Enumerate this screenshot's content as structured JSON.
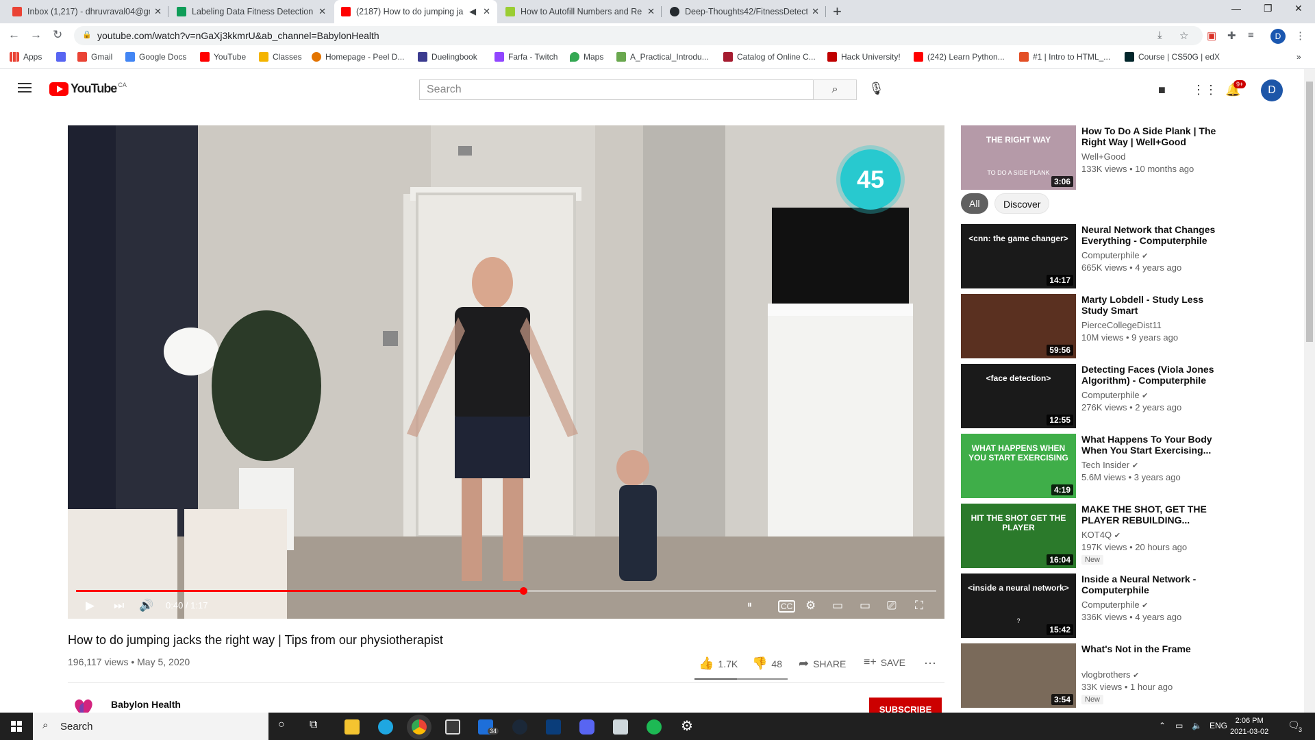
{
  "browser": {
    "tabs": [
      {
        "label": "Inbox (1,217) - dhruvraval04@gm",
        "favicon": "gmail-icon",
        "active": false
      },
      {
        "label": "Labeling Data Fitness Detection",
        "favicon": "sheets-icon",
        "active": false
      },
      {
        "label": "(2187) How to do jumping ja",
        "favicon": "youtube-icon",
        "active": true
      },
      {
        "label": "How to Autofill Numbers and Re",
        "favicon": "howtogeek-icon",
        "active": false
      },
      {
        "label": "Deep-Thoughts42/FitnessDetect",
        "favicon": "github-icon",
        "active": false
      }
    ],
    "address": "youtube.com/watch?v=nGaXj3kkmrU&ab_channel=BabylonHealth",
    "profile_initial": "D",
    "bookmarks": [
      {
        "label": "Apps",
        "color": "#ea4335"
      },
      {
        "label": "",
        "color": "#5865f2"
      },
      {
        "label": "Gmail",
        "color": "#ea4335"
      },
      {
        "label": "Google Docs",
        "color": "#4285f4"
      },
      {
        "label": "YouTube",
        "color": "#ff0000"
      },
      {
        "label": "Classes",
        "color": "#f4b400"
      },
      {
        "label": "Homepage - Peel D...",
        "color": "#e37400"
      },
      {
        "label": "Duelingbook",
        "color": "#3b3b8f"
      },
      {
        "label": "Farfa - Twitch",
        "color": "#9146ff"
      },
      {
        "label": "Maps",
        "color": "#34a853"
      },
      {
        "label": "A_Practical_Introdu...",
        "color": "#6aa84f"
      },
      {
        "label": "Catalog of Online C...",
        "color": "#a51c30"
      },
      {
        "label": "Hack University!",
        "color": "#c00000"
      },
      {
        "label": "(242) Learn Python...",
        "color": "#ff0000"
      },
      {
        "label": "#1 | Intro to HTML_...",
        "color": "#e34f26"
      },
      {
        "label": "Course | CS50G | edX",
        "color": "#02262b"
      }
    ]
  },
  "youtube": {
    "logo_text": "YouTube",
    "region": "CA",
    "search_placeholder": "Search",
    "notification_count": "9+",
    "avatar_initial": "D"
  },
  "player": {
    "time": "0:40 / 1:17",
    "progress": 0.52,
    "overlay_counter": "45"
  },
  "video": {
    "title": "How to do jumping jacks the right way | Tips from our physiotherapist",
    "meta": "196,117 views • May 5, 2020",
    "likes": "1.7K",
    "dislikes": "48",
    "share_label": "SHARE",
    "save_label": "SAVE",
    "channel": "Babylon Health",
    "subscribe_label": "SUBSCRIBE"
  },
  "chips": [
    "All",
    "Discover"
  ],
  "recommendations": [
    {
      "title": "How To Do A Side Plank | The Right Way | Well+Good",
      "channel": "Well+Good",
      "verified": false,
      "views": "133K views • 10 months ago",
      "duration": "3:06",
      "new": false,
      "thumb_text": "THE RIGHT WAY",
      "thumb_sub": "TO DO A SIDE PLANK",
      "thumb_color": "#b59aa8"
    },
    {
      "title": "Neural Network that Changes Everything - Computerphile",
      "channel": "Computerphile",
      "verified": true,
      "views": "665K views • 4 years ago",
      "duration": "14:17",
      "new": false,
      "thumb_text": "<cnn: the game changer>",
      "thumb_sub": "",
      "thumb_color": "#1a1a1a"
    },
    {
      "title": "Marty Lobdell - Study Less Study Smart",
      "channel": "PierceCollegeDist11",
      "verified": false,
      "views": "10M views • 9 years ago",
      "duration": "59:56",
      "new": false,
      "thumb_text": "",
      "thumb_sub": "",
      "thumb_color": "#5a3020"
    },
    {
      "title": "Detecting Faces (Viola Jones Algorithm) - Computerphile",
      "channel": "Computerphile",
      "verified": true,
      "views": "276K views • 2 years ago",
      "duration": "12:55",
      "new": false,
      "thumb_text": "<face detection>",
      "thumb_sub": "",
      "thumb_color": "#1a1a1a"
    },
    {
      "title": "What Happens To Your Body When You Start Exercising...",
      "channel": "Tech Insider",
      "verified": true,
      "views": "5.6M views • 3 years ago",
      "duration": "4:19",
      "new": false,
      "thumb_text": "WHAT HAPPENS WHEN YOU START EXERCISING",
      "thumb_sub": "",
      "thumb_color": "#3fae49"
    },
    {
      "title": "MAKE THE SHOT, GET THE PLAYER REBUILDING...",
      "channel": "KOT4Q",
      "verified": true,
      "views": "197K views • 20 hours ago",
      "duration": "16:04",
      "new": true,
      "thumb_text": "HIT THE SHOT GET THE PLAYER",
      "thumb_sub": "",
      "thumb_color": "#2b7a2b"
    },
    {
      "title": "Inside a Neural Network - Computerphile",
      "channel": "Computerphile",
      "verified": true,
      "views": "336K views • 4 years ago",
      "duration": "15:42",
      "new": false,
      "thumb_text": "<inside a neural network>",
      "thumb_sub": "?",
      "thumb_color": "#1a1a1a"
    },
    {
      "title": "What's Not in the Frame",
      "channel": "vlogbrothers",
      "verified": true,
      "views": "33K views • 1 hour ago",
      "duration": "3:54",
      "new": true,
      "thumb_text": "",
      "thumb_sub": "",
      "thumb_color": "#7a6a5a"
    }
  ],
  "new_label": "New",
  "taskbar": {
    "search_placeholder": "Search",
    "mail_badge": "34",
    "language": "ENG",
    "time": "2:06 PM",
    "date": "2021-03-02",
    "notif_count": "3"
  }
}
